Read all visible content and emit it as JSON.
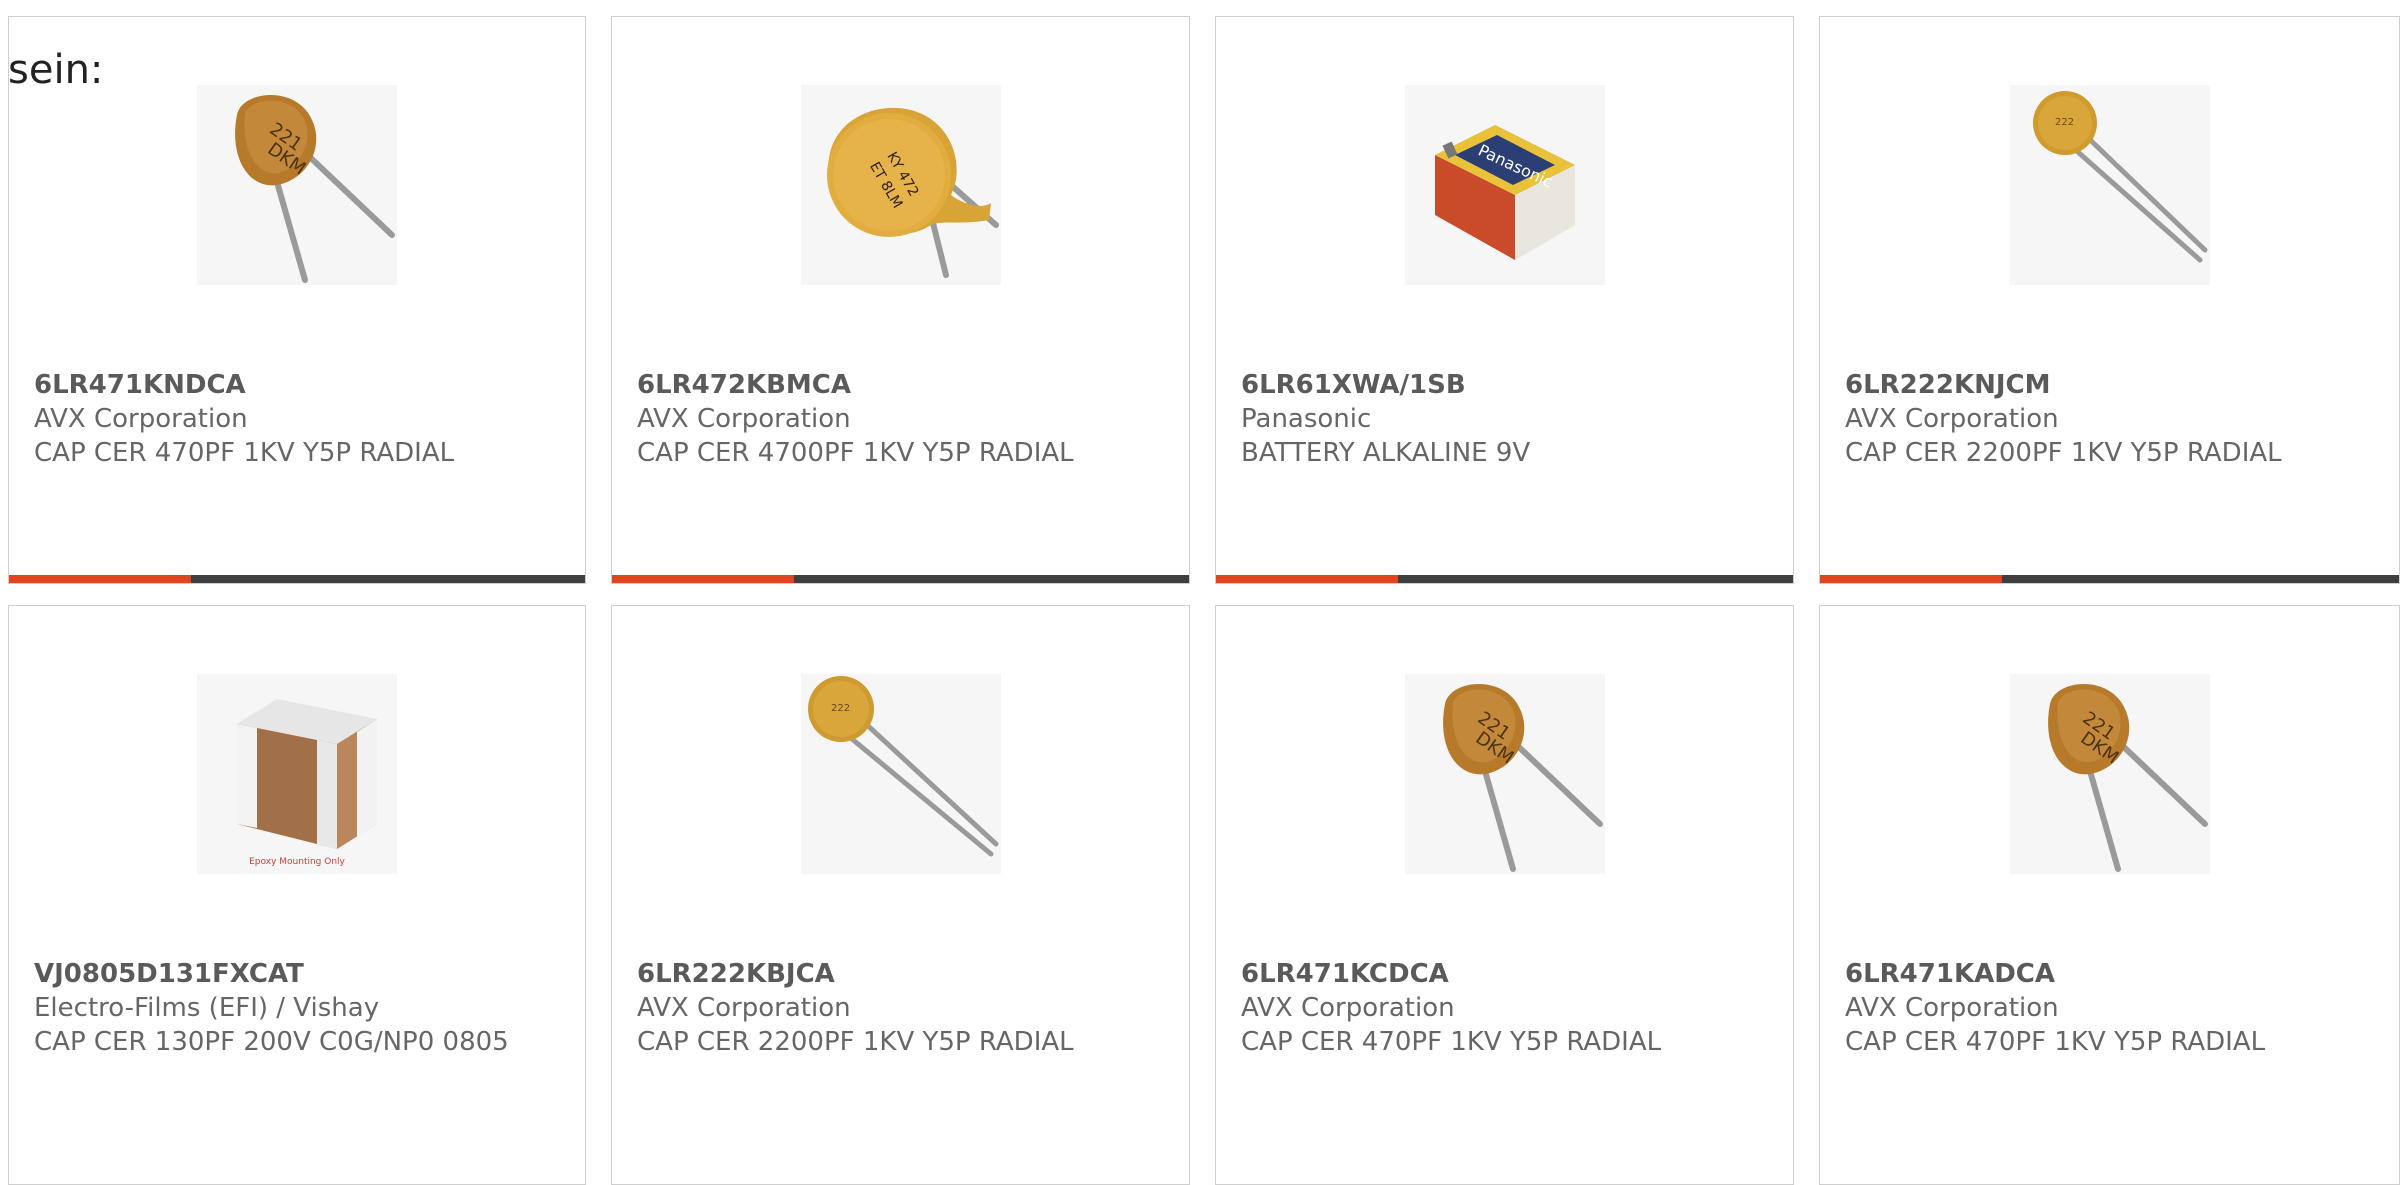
{
  "intro_text": "sein:",
  "colors": {
    "accent": "#e2441f",
    "bar_dark": "#3f3f3f",
    "border": "#cfcfcf",
    "text": "#666666"
  },
  "products": [
    {
      "part_number": "6LR471KNDCA",
      "manufacturer": "AVX Corporation",
      "description": "CAP CER 470PF 1KV Y5P RADIAL",
      "icon": "disc-capacitor-image",
      "marking": "221\nDKM"
    },
    {
      "part_number": "6LR472KBMCA",
      "manufacturer": "AVX Corporation",
      "description": "CAP CER 4700PF 1KV Y5P RADIAL",
      "icon": "large-disc-capacitor-image"
    },
    {
      "part_number": "6LR61XWA/1SB",
      "manufacturer": "Panasonic",
      "description": "BATTERY ALKALINE 9V",
      "icon": "battery-9v-image",
      "marking": "Panasonic"
    },
    {
      "part_number": "6LR222KNJCM",
      "manufacturer": "AVX Corporation",
      "description": "CAP CER 2200PF 1KV Y5P RADIAL",
      "icon": "small-disc-capacitor-image"
    },
    {
      "part_number": "VJ0805D131FXCAT",
      "manufacturer": "Electro-Films (EFI) / Vishay",
      "description": "CAP CER 130PF 200V C0G/NP0 0805",
      "icon": "smd-capacitor-image",
      "marking": "Epoxy Mounting Only"
    },
    {
      "part_number": "6LR222KBJCA",
      "manufacturer": "AVX Corporation",
      "description": "CAP CER 2200PF 1KV Y5P RADIAL",
      "icon": "small-disc-capacitor-image"
    },
    {
      "part_number": "6LR471KCDCA",
      "manufacturer": "AVX Corporation",
      "description": "CAP CER 470PF 1KV Y5P RADIAL",
      "icon": "disc-capacitor-image",
      "marking": "221\nDKM"
    },
    {
      "part_number": "6LR471KADCA",
      "manufacturer": "AVX Corporation",
      "description": "CAP CER 470PF 1KV Y5P RADIAL",
      "icon": "disc-capacitor-image",
      "marking": "221\nDKM"
    }
  ]
}
